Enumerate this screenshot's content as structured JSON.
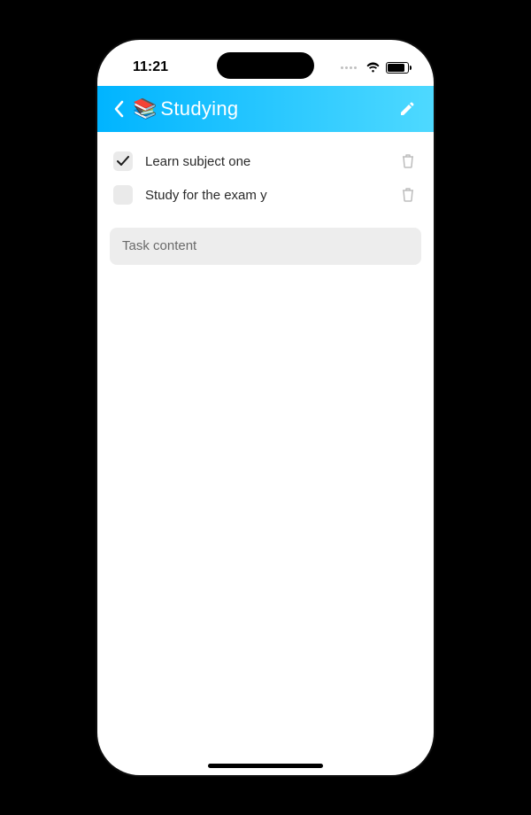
{
  "status": {
    "time": "11:21"
  },
  "header": {
    "emoji": "📚",
    "title": "Studying"
  },
  "tasks": [
    {
      "label": "Learn subject one",
      "checked": true
    },
    {
      "label": "Study for the exam y",
      "checked": false
    }
  ],
  "input": {
    "placeholder": "Task content"
  }
}
